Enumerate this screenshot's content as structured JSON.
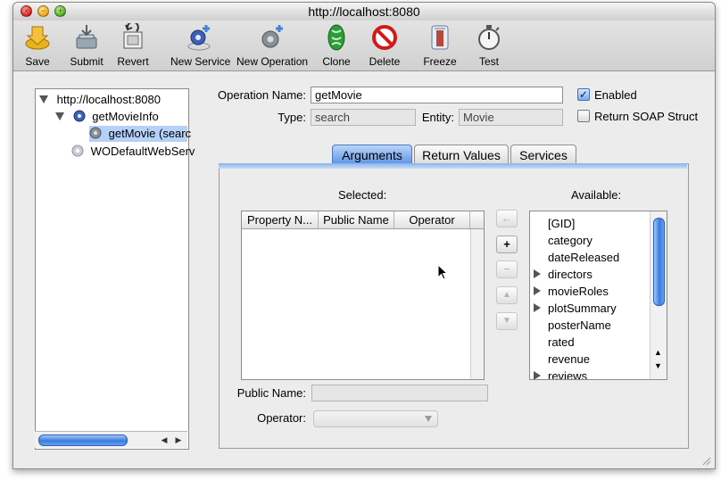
{
  "window": {
    "title": "http://localhost:8080"
  },
  "toolbar": {
    "items": [
      {
        "label": "Save",
        "icon": "save-icon"
      },
      {
        "label": "Submit",
        "icon": "submit-icon"
      },
      {
        "label": "Revert",
        "icon": "revert-icon"
      },
      {
        "label": "New Service",
        "icon": "new-service-icon"
      },
      {
        "label": "New Operation",
        "icon": "new-operation-icon"
      },
      {
        "label": "Clone",
        "icon": "clone-icon"
      },
      {
        "label": "Delete",
        "icon": "delete-icon"
      },
      {
        "label": "Freeze",
        "icon": "freeze-icon"
      },
      {
        "label": "Test",
        "icon": "test-icon"
      }
    ]
  },
  "tree": {
    "root": "http://localhost:8080",
    "service": "getMovieInfo",
    "operation": "getMovie (searc",
    "service2": "WODefaultWebServ"
  },
  "form": {
    "operation_name_label": "Operation Name:",
    "operation_name_value": "getMovie",
    "enabled_label": "Enabled",
    "enabled_checked": true,
    "type_label": "Type:",
    "type_value": "search",
    "entity_label": "Entity:",
    "entity_value": "Movie",
    "return_soap_label": "Return SOAP Struct",
    "return_soap_checked": false
  },
  "tabs": [
    {
      "label": "Arguments",
      "selected": true
    },
    {
      "label": "Return Values",
      "selected": false
    },
    {
      "label": "Services",
      "selected": false
    }
  ],
  "arguments": {
    "selected_label": "Selected:",
    "available_label": "Available:",
    "columns": [
      "Property N...",
      "Public Name",
      "Operator"
    ],
    "buttons": {
      "back": "←",
      "add": "+",
      "remove": "−",
      "up": "▲",
      "down": "▼"
    },
    "available": [
      {
        "name": "[GID]",
        "expandable": false
      },
      {
        "name": "category",
        "expandable": false
      },
      {
        "name": "dateReleased",
        "expandable": false
      },
      {
        "name": "directors",
        "expandable": true
      },
      {
        "name": "movieRoles",
        "expandable": true
      },
      {
        "name": "plotSummary",
        "expandable": true
      },
      {
        "name": "posterName",
        "expandable": false
      },
      {
        "name": "rated",
        "expandable": false
      },
      {
        "name": "revenue",
        "expandable": false
      },
      {
        "name": "reviews",
        "expandable": true
      }
    ],
    "public_name_label": "Public Name:",
    "public_name_value": "",
    "operator_label": "Operator:",
    "operator_value": ""
  },
  "colors": {
    "accent": "#5d94e6",
    "window_bg": "#ececec",
    "selection": "#b5d1f7"
  }
}
